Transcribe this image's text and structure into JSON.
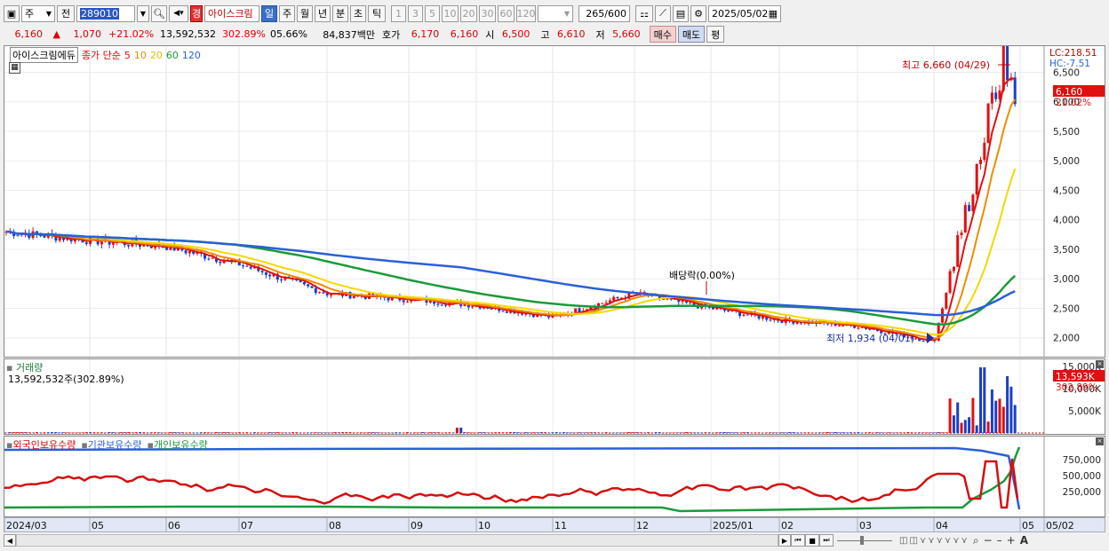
{
  "toolbar": {
    "market": "주",
    "mode": "전",
    "code": "289010",
    "name": "아이스크림",
    "badge": "경",
    "periods": [
      "일",
      "주",
      "월",
      "년",
      "분",
      "초",
      "틱"
    ],
    "active_period": "일",
    "intervals": [
      "1",
      "3",
      "5",
      "10",
      "20",
      "30",
      "60",
      "120"
    ],
    "count": "265",
    "count_total": "/600",
    "date": "2025/05/02"
  },
  "quote": {
    "price": "6,160",
    "arrow": "▲",
    "change": "1,070",
    "change_pct": "+21.02%",
    "volume": "13,592,532",
    "volume_pct": "302.89%",
    "turnover_pct": "05.66%",
    "amount": "84,837백만",
    "ask_label": "호가",
    "ask": "6,170",
    "bid": "6,160",
    "open_label": "시",
    "open": "6,500",
    "high_label": "고",
    "high": "6,610",
    "low_label": "저",
    "low": "5,660",
    "buy": "매수",
    "sell": "매도",
    "avg": "평"
  },
  "price_panel": {
    "title": "아이스크림에듀",
    "ma_label": "종가 단순",
    "ma_periods": [
      "5",
      "10",
      "20",
      "60",
      "120"
    ],
    "ma_colors": [
      "#e01010",
      "#f08c00",
      "#f5d800",
      "#1a9a3a",
      "#2a5fd8"
    ],
    "lc": "LC:218.51",
    "hc": "HC:-7.51",
    "last_price": "6,160",
    "last_pct": "21.02%",
    "high_note": "최고 6,660 (04/29)",
    "low_note": "최저 1,934 (04/01)",
    "dividend_note": "배당락(0.00%)",
    "y_ticks": [
      "6,500",
      "6,000",
      "5,500",
      "5,000",
      "4,500",
      "4,000",
      "3,500",
      "3,000",
      "2,500",
      "2,000"
    ]
  },
  "volume_panel": {
    "title": "거래량",
    "value": "13,592,532주(302.89%)",
    "y_ticks": [
      "15,000K",
      "10,000K",
      "5,000K"
    ],
    "last": "13,593K",
    "last_pct": "302.89%"
  },
  "holding_panel": {
    "labels": [
      "외국인보유수량",
      "기관보유수량",
      "개인보유수량"
    ],
    "y_ticks": [
      "750,000",
      "500,000",
      "250,000"
    ]
  },
  "x_axis": {
    "labels": [
      "2024/03",
      "05",
      "06",
      "07",
      "08",
      "09",
      "10",
      "11",
      "12",
      "2025/01",
      "02",
      "03",
      "04",
      "05",
      "05/02"
    ]
  },
  "chart_data": {
    "type": "line",
    "title": "아이스크림에듀",
    "series_price_close_approx": {
      "x": [
        "2024/03",
        "05",
        "06",
        "07",
        "08",
        "09",
        "10",
        "11",
        "12",
        "2025/01",
        "02",
        "03",
        "04",
        "04/29",
        "05/02"
      ],
      "values": [
        3800,
        3650,
        3550,
        3250,
        2750,
        2650,
        2550,
        2350,
        2750,
        2500,
        2300,
        2200,
        1934,
        6660,
        6160
      ]
    },
    "ylim": [
      1800,
      6800
    ]
  }
}
